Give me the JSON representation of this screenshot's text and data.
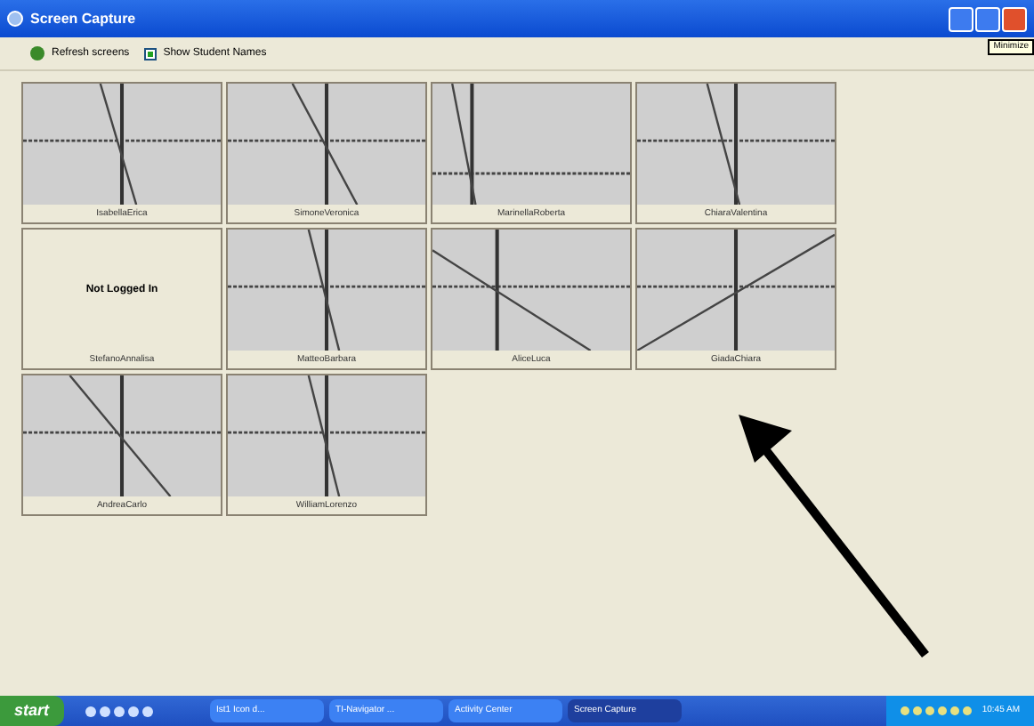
{
  "window": {
    "title": "Screen Capture",
    "tooltip": "Minimize"
  },
  "toolbar": {
    "refresh": "Refresh screens",
    "show_names": {
      "label": "Show Student Names",
      "checked": true
    }
  },
  "tiles": [
    {
      "kind": "graph",
      "name": "IsabellaErica"
    },
    {
      "kind": "graph",
      "name": "SimoneVeronica"
    },
    {
      "kind": "graph",
      "name": "MarinellaRoberta"
    },
    {
      "kind": "graph",
      "name": "ChiaraValentina"
    },
    {
      "kind": "offline",
      "name": "StefanoAnnalisa",
      "message": "Not Logged In"
    },
    {
      "kind": "graph",
      "name": "MatteoBarbara"
    },
    {
      "kind": "graph",
      "name": "AliceLuca"
    },
    {
      "kind": "graph",
      "name": "GiadaChiara"
    },
    {
      "kind": "graph",
      "name": "AndreaCarlo"
    },
    {
      "kind": "graph",
      "name": "WilliamLorenzo"
    }
  ],
  "taskbar": {
    "start": "start",
    "tasks": [
      {
        "label": "Ist1 Icon d...",
        "selected": false
      },
      {
        "label": "TI-Navigator ...",
        "selected": false
      },
      {
        "label": "Activity Center",
        "selected": false
      },
      {
        "label": "Screen Capture",
        "selected": true
      }
    ],
    "clock": "10:45 AM"
  }
}
